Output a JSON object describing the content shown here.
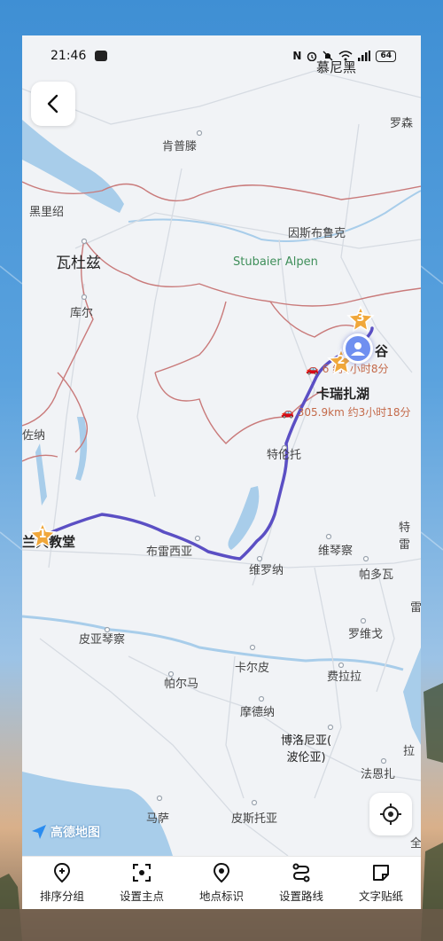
{
  "status_bar": {
    "time": "21:46",
    "battery": "64",
    "icons": [
      "message-icon",
      "nfc-icon",
      "alarm-icon",
      "mute-icon",
      "wifi-icon",
      "signal-icon",
      "battery-icon"
    ]
  },
  "map": {
    "place_labels": [
      {
        "id": "munich",
        "text": "慕尼黑"
      },
      {
        "id": "rosenheim",
        "text": "罗森"
      },
      {
        "id": "kempten",
        "text": "肯普滕"
      },
      {
        "id": "dornbirn",
        "text": "黑里绍"
      },
      {
        "id": "feldkirch",
        "text": "瓦杜兹"
      },
      {
        "id": "innsbruck",
        "text": "因斯布鲁克"
      },
      {
        "id": "stubaier",
        "text": "Stubaier Alpen"
      },
      {
        "id": "chur",
        "text": "库尔"
      },
      {
        "id": "lugano",
        "text": "佐纳"
      },
      {
        "id": "trento",
        "text": "特伦托"
      },
      {
        "id": "milan",
        "text": "兰大教堂"
      },
      {
        "id": "brescia",
        "text": "布雷西亚"
      },
      {
        "id": "verona",
        "text": "维罗纳"
      },
      {
        "id": "vicenza",
        "text": "维琴察"
      },
      {
        "id": "padova",
        "text": "帕多瓦"
      },
      {
        "id": "rovigo",
        "text": "罗维戈"
      },
      {
        "id": "piacenza",
        "text": "皮亚琴察"
      },
      {
        "id": "carpi",
        "text": "卡尔皮"
      },
      {
        "id": "ferrara",
        "text": "费拉拉"
      },
      {
        "id": "parma",
        "text": "帕尔马"
      },
      {
        "id": "modena",
        "text": "摩德纳"
      },
      {
        "id": "bologna",
        "text": "博洛尼亚(\n波伦亚)"
      },
      {
        "id": "faenza",
        "text": "法恩扎"
      },
      {
        "id": "massa",
        "text": "马萨"
      },
      {
        "id": "pistoia",
        "text": "皮斯托亚"
      },
      {
        "id": "treviso",
        "text": "特雷"
      },
      {
        "id": "north_valley",
        "text": "谷"
      },
      {
        "id": "right_edge_1",
        "text": "雷"
      },
      {
        "id": "right_edge_2",
        "text": "拉"
      },
      {
        "id": "right_edge_3",
        "text": "全"
      }
    ],
    "route_points": [
      {
        "number": "1",
        "name": "兰大教堂"
      },
      {
        "number": "2",
        "name": "卡瑞扎湖"
      },
      {
        "number": "3",
        "name": "谷"
      }
    ],
    "route_segments": [
      {
        "id": "seg1",
        "distance": "305.9km",
        "duration": "约3小时18分"
      },
      {
        "id": "seg2",
        "distance": "6",
        "duration": "约1小时8分"
      }
    ],
    "logo_text": "高德地图"
  },
  "toolbar": {
    "items": [
      {
        "label": "排序分组",
        "icon": "add-location-icon"
      },
      {
        "label": "设置主点",
        "icon": "focus-point-icon"
      },
      {
        "label": "地点标识",
        "icon": "location-pin-icon"
      },
      {
        "label": "设置路线",
        "icon": "route-icon"
      },
      {
        "label": "文字贴纸",
        "icon": "sticker-icon"
      }
    ]
  },
  "colors": {
    "route": "#5b4fc4",
    "border": "#c97a7a",
    "water": "#a8cdea",
    "land": "#f1f3f6",
    "road": "#d9dde3",
    "star": "#f0a73a"
  }
}
